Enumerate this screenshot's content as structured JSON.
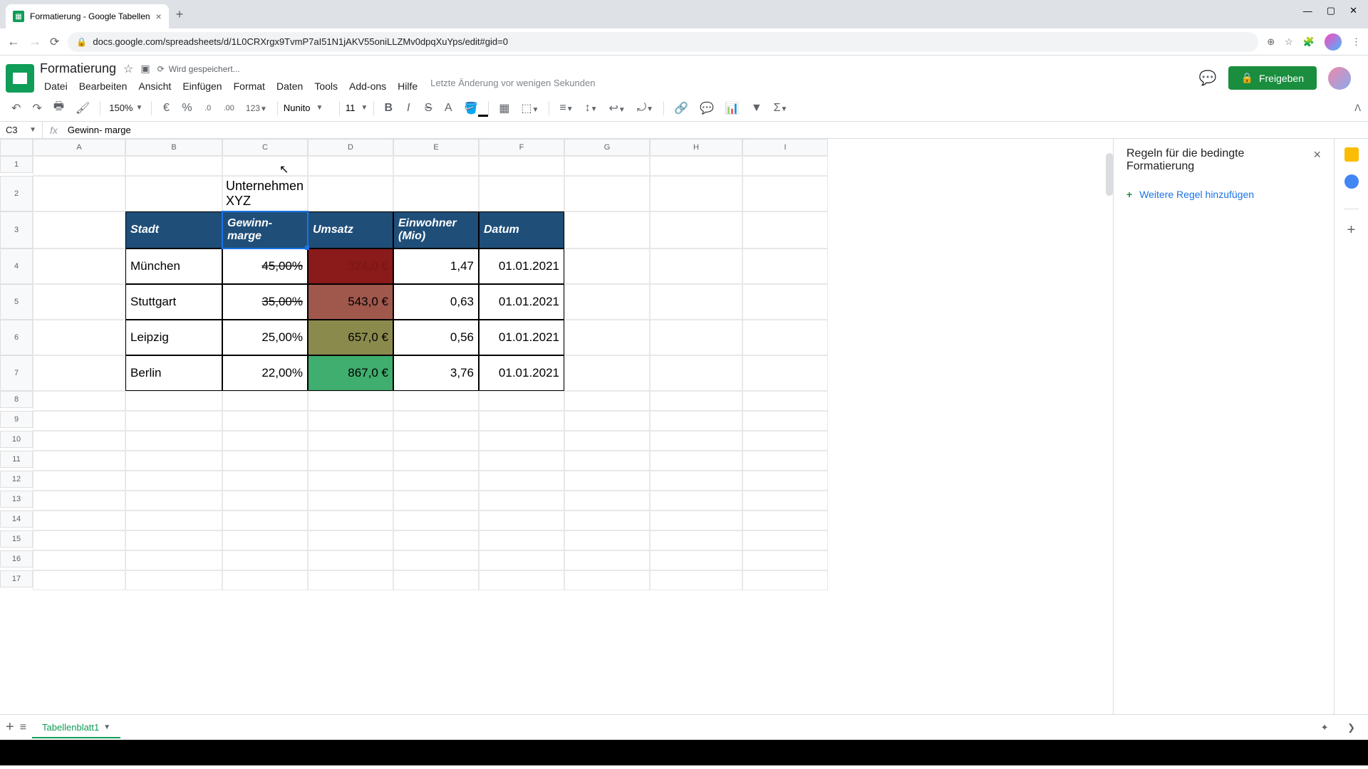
{
  "browser": {
    "tab_title": "Formatierung - Google Tabellen",
    "url": "docs.google.com/spreadsheets/d/1L0CRXrgx9TvmP7aI51N1jAKV55oniLLZMv0dpqXuYps/edit#gid=0"
  },
  "doc": {
    "title": "Formatierung",
    "save_status": "Wird gespeichert...",
    "last_edit": "Letzte Änderung vor wenigen Sekunden"
  },
  "menu": [
    "Datei",
    "Bearbeiten",
    "Ansicht",
    "Einfügen",
    "Format",
    "Daten",
    "Tools",
    "Add-ons",
    "Hilfe"
  ],
  "toolbar": {
    "zoom": "150%",
    "currency": "€",
    "percent": "%",
    "dec_dec": ".0",
    "inc_dec": ".00",
    "num_fmt": "123",
    "font": "Nunito",
    "font_size": "11"
  },
  "namebox": "C3",
  "formula": "Gewinn- marge",
  "columns": [
    "A",
    "B",
    "C",
    "D",
    "E",
    "F",
    "G",
    "H",
    "I"
  ],
  "rows": [
    "1",
    "2",
    "3",
    "4",
    "5",
    "6",
    "7",
    "8",
    "9",
    "10",
    "11",
    "12",
    "13",
    "14",
    "15",
    "16",
    "17"
  ],
  "table": {
    "title": "Unternehmen XYZ",
    "headers": {
      "b": "Stadt",
      "c": "Gewinn-marge",
      "d": "Umsatz",
      "e": "Einwohner (Mio)",
      "f": "Datum"
    },
    "rows": [
      {
        "city": "München",
        "margin": "45,00%",
        "revenue": "324,0 €",
        "pop": "1,47",
        "date": "01.01.2021",
        "strike": true,
        "dclass": "d4"
      },
      {
        "city": "Stuttgart",
        "margin": "35,00%",
        "revenue": "543,0 €",
        "pop": "0,63",
        "date": "01.01.2021",
        "strike": true,
        "dclass": "d5"
      },
      {
        "city": "Leipzig",
        "margin": "25,00%",
        "revenue": "657,0 €",
        "pop": "0,56",
        "date": "01.01.2021",
        "strike": false,
        "dclass": "d6"
      },
      {
        "city": "Berlin",
        "margin": "22,00%",
        "revenue": "867,0 €",
        "pop": "3,76",
        "date": "01.01.2021",
        "strike": false,
        "dclass": "d7"
      }
    ]
  },
  "sidebar": {
    "title": "Regeln für die bedingte Formatierung",
    "add_rule": "Weitere Regel hinzufügen"
  },
  "share": "Freigeben",
  "sheet_tab": "Tabellenblatt1"
}
